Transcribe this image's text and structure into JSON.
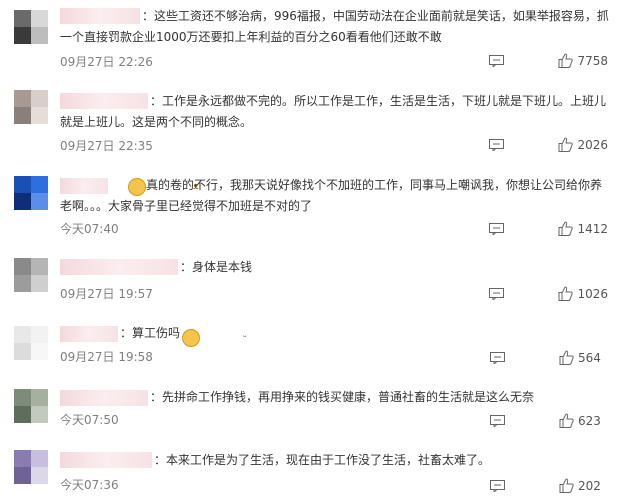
{
  "comments": [
    {
      "text": "：这些工资还不够治病，996福报，中国劳动法在企业面前就是笑话，如果举报容易，抓一个直接罚款企业1000万还要扣上年利益的百分之60看看他们还敢不敢",
      "time": "09月27日 22:26",
      "likes": "7758",
      "avatar": [
        "#6a6a6a",
        "#d8d8d8",
        "#3a3a3a",
        "#bdbdbd"
      ]
    },
    {
      "text": "：工作是永远都做不完的。所以工作是工作，生活是生活，下班儿就是下班儿。上班儿就是上班儿。这是两个不同的概念。",
      "time": "09月27日 22:35",
      "likes": "2026",
      "avatar": [
        "#a89a92",
        "#d9cfc9",
        "#8a7f7a",
        "#e6ddd8"
      ]
    },
    {
      "text": "真的卷的不行，我那天说好像找个不加班的工作，同事马上嘲讽我，你想让公司给你养老啊。。。大家骨子里已经觉得不加班是不对的了",
      "time": "今天07:40",
      "likes": "1412",
      "avatar": [
        "#1a4fb5",
        "#2d6fe0",
        "#0f2e7a",
        "#5a8ee8"
      ]
    },
    {
      "text": "：身体是本钱",
      "time": "09月27日 19:57",
      "likes": "1026",
      "avatar": [
        "#8a8a8a",
        "#b5b5b5",
        "#9c9c9c",
        "#cfcfcf"
      ]
    },
    {
      "text": "：算工伤吗",
      "time": "09月27日 19:58",
      "likes": "564",
      "avatar": [
        "#e8e8e8",
        "#f2f2f2",
        "#dcdcdc",
        "#f7f7f7"
      ]
    },
    {
      "text": "：先拼命工作挣钱，再用挣来的钱买健康，普通社畜的生活就是这么无奈",
      "time": "今天07:50",
      "likes": "623",
      "avatar": [
        "#7d8c7a",
        "#a5b09f",
        "#5f6e5c",
        "#c2cabd"
      ]
    },
    {
      "text": "：本来工作是为了生活，现在由于工作没了生活，社畜太难了。",
      "time": "今天07:36",
      "likes": "202",
      "avatar": [
        "#8a7bb0",
        "#c7bfdc",
        "#6f6396",
        "#ddd7ea"
      ]
    }
  ],
  "icons": {
    "comment": "comment-icon",
    "like": "thumbs-up-icon",
    "emoji_cat": "cat-face-emoji-icon",
    "emoji_laugh": "laughing-emoji-icon"
  },
  "colors": {
    "text": "#333333",
    "meta": "#808080",
    "username_blur": "#f3d9dc"
  }
}
